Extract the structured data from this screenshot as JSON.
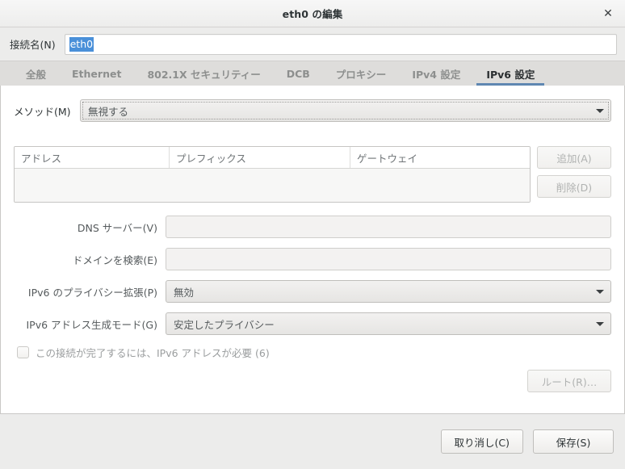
{
  "window": {
    "title": "eth0 の編集",
    "close_icon": "close-icon",
    "close_glyph": "✕"
  },
  "connection": {
    "label": "接続名(N)",
    "value": "eth0",
    "selected": true,
    "selection_color": "#4a90d9"
  },
  "tabs": [
    {
      "label": "全般",
      "active": false
    },
    {
      "label": "Ethernet",
      "active": false
    },
    {
      "label": "802.1X セキュリティー",
      "active": false
    },
    {
      "label": "DCB",
      "active": false
    },
    {
      "label": "プロキシー",
      "active": false
    },
    {
      "label": "IPv4 設定",
      "active": false
    },
    {
      "label": "IPv6 設定",
      "active": true
    }
  ],
  "active_tab_underline_color": "#5f87b1",
  "method": {
    "label": "メソッド(M)",
    "value": "無視する",
    "arrow_icon": "chevron-down-icon",
    "focused": true
  },
  "address_table": {
    "columns": [
      "アドレス",
      "プレフィックス",
      "ゲートウェイ"
    ],
    "rows": [],
    "add_button": "追加(A)",
    "delete_button": "削除(D)",
    "add_enabled": false,
    "delete_enabled": false
  },
  "fields": {
    "dns": {
      "label": "DNS サーバー(V)",
      "value": "",
      "placeholder": ""
    },
    "search_domains": {
      "label": "ドメインを検索(E)",
      "value": "",
      "placeholder": ""
    },
    "privacy_extensions": {
      "label": "IPv6 のプライバシー拡張(P)",
      "value": "無効",
      "arrow_icon": "chevron-down-icon"
    },
    "addr_gen_mode": {
      "label": "IPv6 アドレス生成モード(G)",
      "value": "安定したプライバシー",
      "arrow_icon": "chevron-down-icon"
    }
  },
  "require_ipv6": {
    "label": "この接続が完了するには、IPv6 アドレスが必要 (6)",
    "checked": false
  },
  "routes": {
    "label": "ルート(R)…",
    "enabled": false
  },
  "footer": {
    "cancel": "取り消し(C)",
    "save": "保存(S)"
  }
}
